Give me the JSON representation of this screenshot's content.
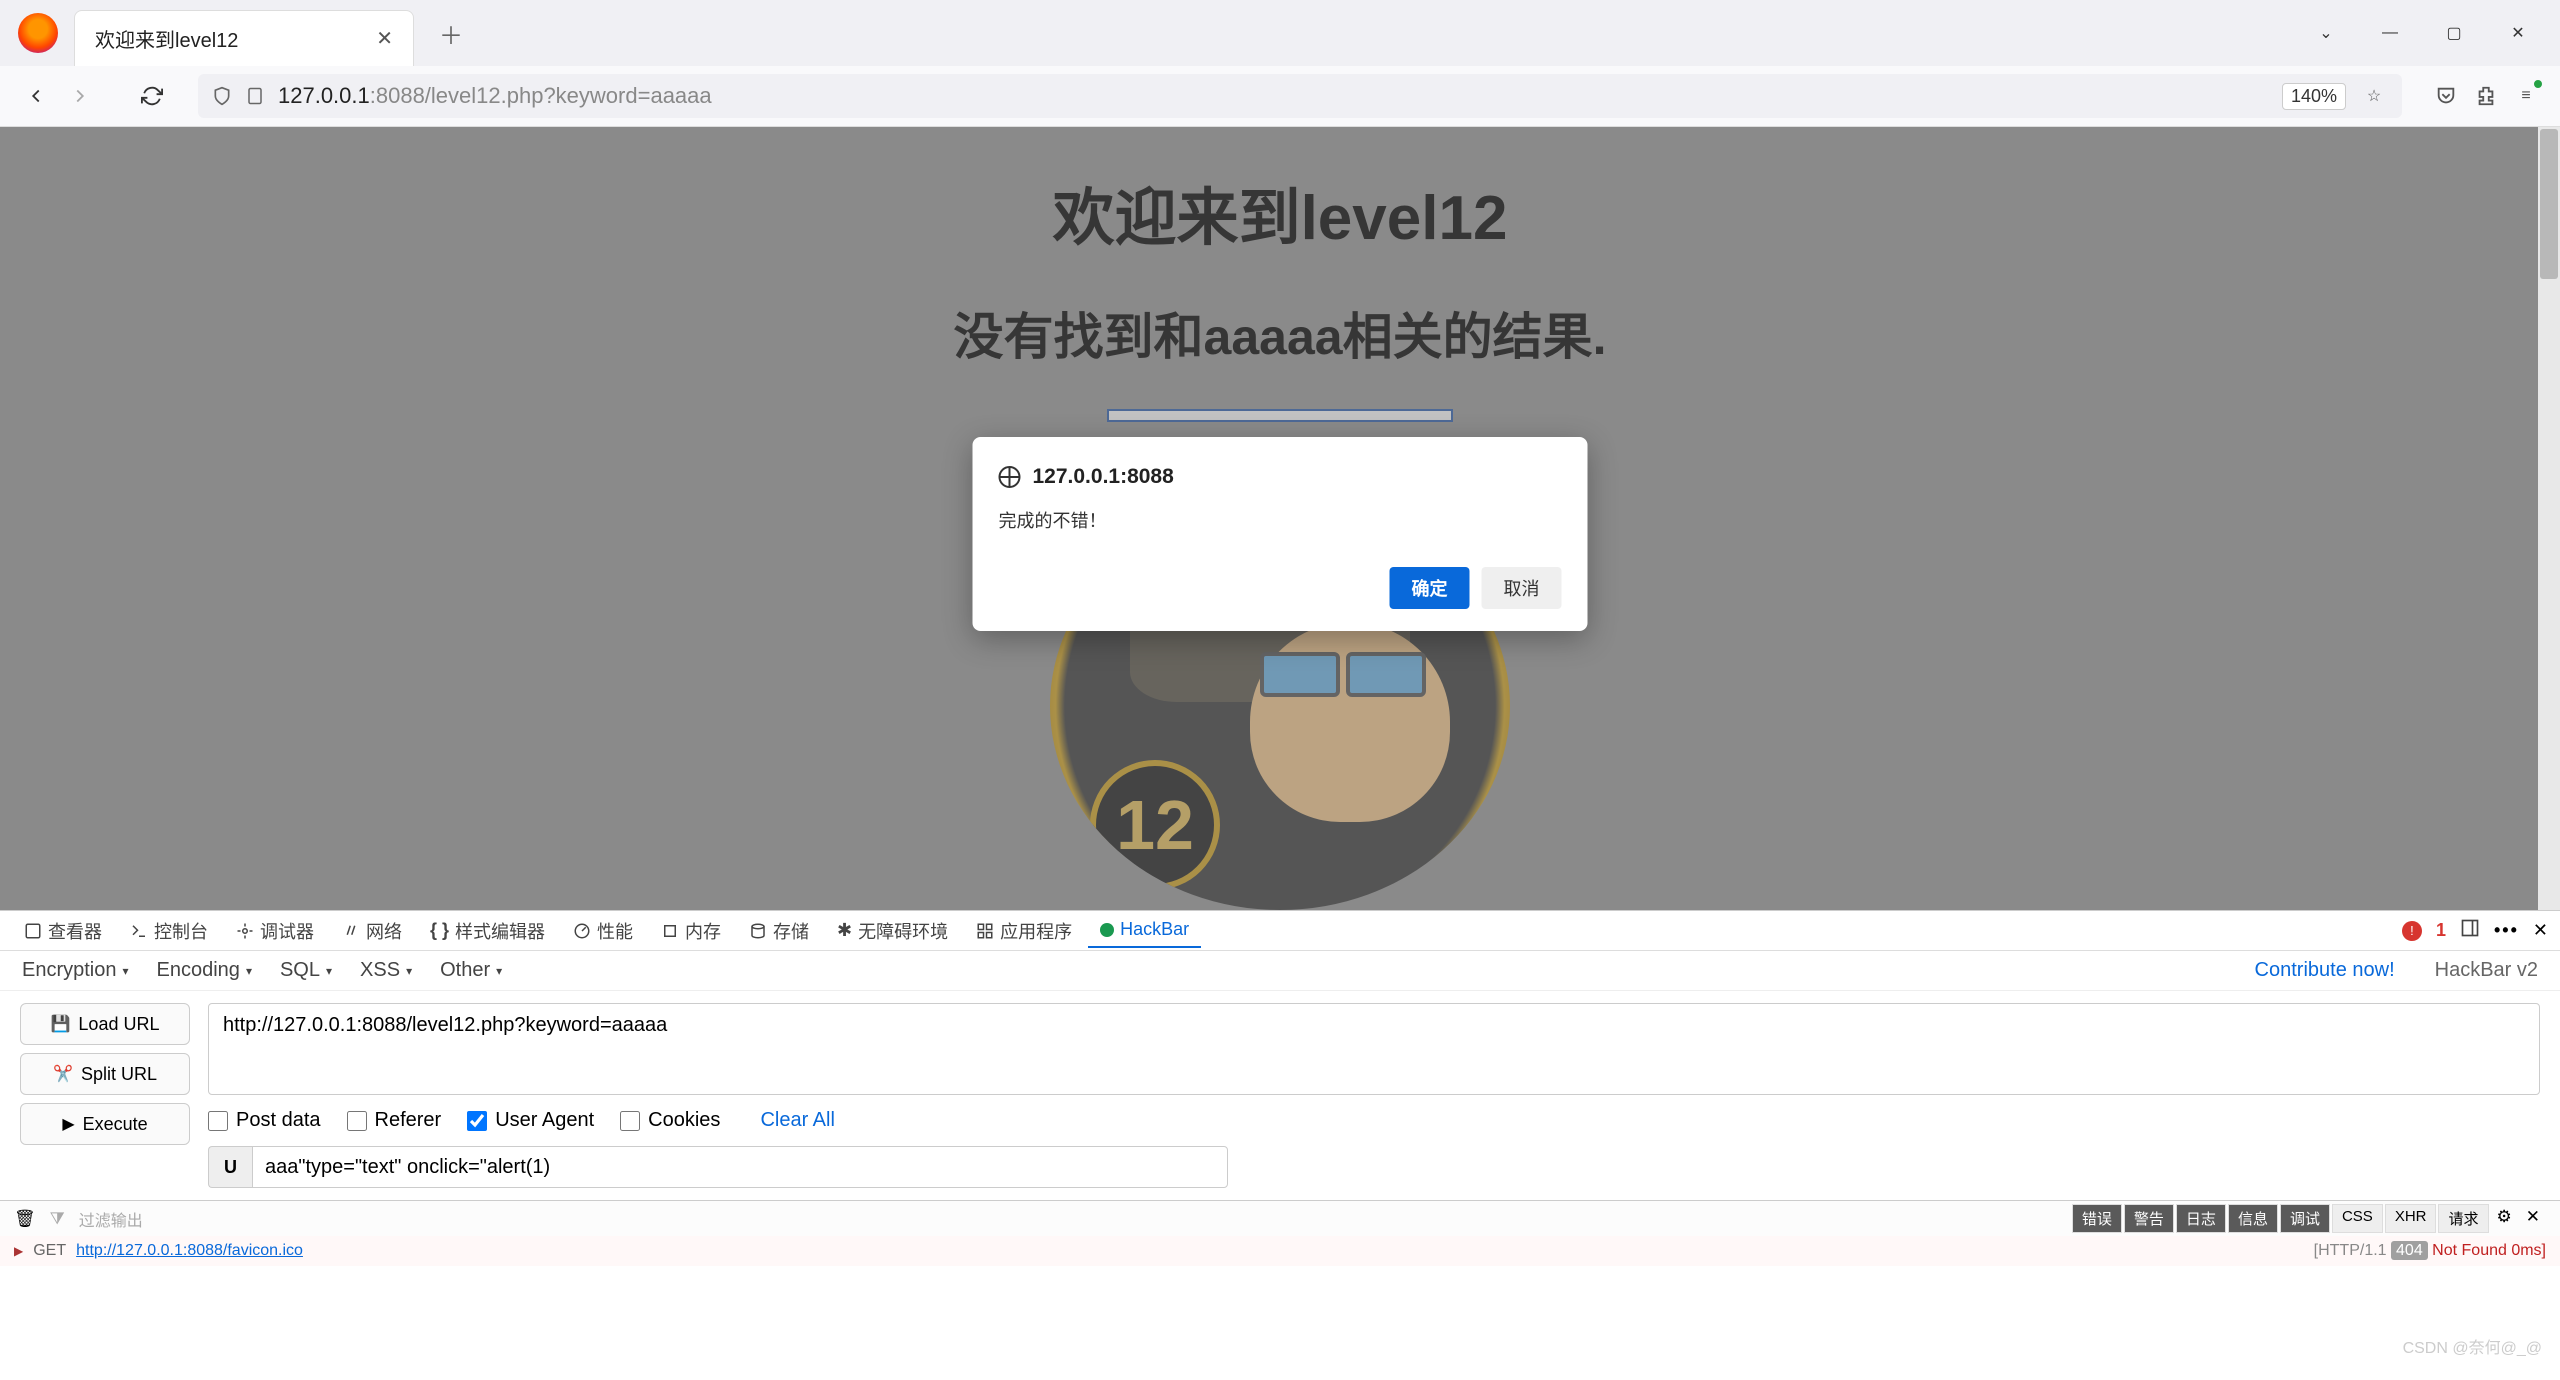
{
  "browser": {
    "tab_title": "欢迎来到level12",
    "url_host": "127.0.0.1",
    "url_port_path": ":8088/level12.php?keyword=aaaaa",
    "zoom": "140%"
  },
  "page": {
    "heading": "欢迎来到level12",
    "subheading": "没有找到和aaaaa相关的结果.",
    "badge_number": "12"
  },
  "dialog": {
    "origin": "127.0.0.1:8088",
    "message": "完成的不错！",
    "ok": "确定",
    "cancel": "取消"
  },
  "devtools": {
    "tabs": {
      "inspector": "查看器",
      "console": "控制台",
      "debugger": "调试器",
      "network": "网络",
      "style": "样式编辑器",
      "perf": "性能",
      "memory": "内存",
      "storage": "存储",
      "a11y": "无障碍环境",
      "app": "应用程序",
      "hackbar": "HackBar"
    },
    "error_count": "1",
    "toolbar": {
      "encryption": "Encryption",
      "encoding": "Encoding",
      "sql": "SQL",
      "xss": "XSS",
      "other": "Other",
      "contribute": "Contribute now!",
      "version": "HackBar v2"
    },
    "buttons": {
      "load": "Load URL",
      "split": "Split URL",
      "execute": "Execute"
    },
    "url_value": "http://127.0.0.1:8088/level12.php?keyword=aaaaa",
    "opts": {
      "post": "Post data",
      "referer": "Referer",
      "ua": "User Agent",
      "cookies": "Cookies",
      "clear": "Clear All"
    },
    "ua_badge": "U",
    "ua_value": "aaa\"type=\"text\" onclick=\"alert(1)"
  },
  "console": {
    "filter_placeholder": "过滤输出",
    "chips": {
      "err": "错误",
      "warn": "警告",
      "log": "日志",
      "info": "信息",
      "dbg": "调试",
      "css": "CSS",
      "xhr": "XHR",
      "req": "请求"
    },
    "method": "GET",
    "req_url": "http://127.0.0.1:8088/favicon.ico",
    "proto": "[HTTP/1.1",
    "code": "404",
    "status_text": "Not Found 0ms]"
  },
  "watermark": "CSDN @奈何@_@"
}
